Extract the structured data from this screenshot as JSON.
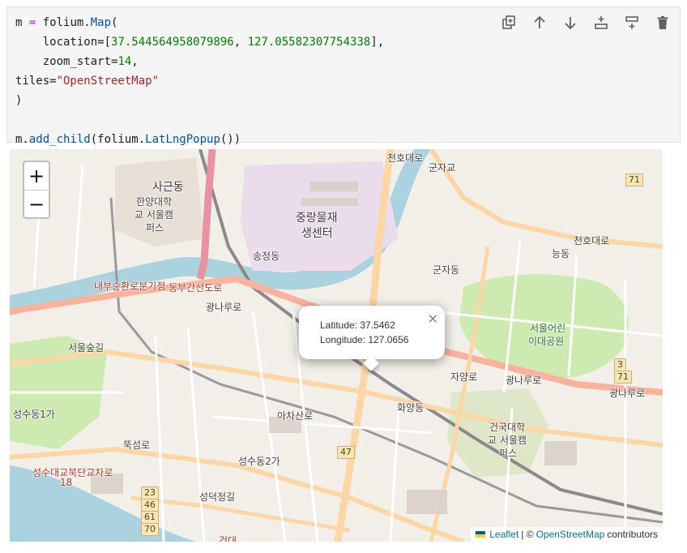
{
  "cell": {
    "code_lines": [
      [
        "m ",
        "=",
        " folium.",
        "Map",
        "("
      ],
      [
        "    location=[",
        "37.544564958079896",
        ", ",
        "127.05582307754338",
        "],"
      ],
      [
        "    zoom_start=",
        "14",
        ","
      ],
      [
        "tiles=",
        "\"OpenStreetMap\""
      ],
      [
        ")"
      ],
      [
        ""
      ],
      [
        "m.",
        "add_child",
        "(folium.",
        "LatLngPopup",
        "())"
      ]
    ],
    "toolbar": [
      {
        "name": "duplicate-icon"
      },
      {
        "name": "arrow-up-icon"
      },
      {
        "name": "arrow-down-icon"
      },
      {
        "name": "insert-above-icon"
      },
      {
        "name": "insert-below-icon"
      },
      {
        "name": "trash-icon"
      }
    ]
  },
  "map": {
    "zoom_in": "+",
    "zoom_out": "−",
    "labels": {
      "sageun": "사근동",
      "hanyang1": "한양대학",
      "hanyang2": "교 서울캠",
      "hanyang3": "퍼스",
      "jungnang1": "중랑물재",
      "jungnang2": "생센터",
      "songjeong": "송정동",
      "gunja": "군자동",
      "gunjagyo": "군자교",
      "neung": "능동",
      "childpark1": "서울어린",
      "childpark2": "이대공원",
      "seoulsup": "서울숲길",
      "hwayang": "화양동",
      "konkuk1": "건국대학",
      "konkuk2": "교 서울캠",
      "konkuk3": "퍼스",
      "seongsu1": "성수동1가",
      "seongsu2": "성수동2가",
      "seongdeok": "성덕정길",
      "ttukseom": "뚝섬로",
      "achasan": "아차산로",
      "gwangnaru": "광나루로",
      "jayang": "자양로",
      "seongsubr": "성수대교북단교차로",
      "cheonho": "천호대로",
      "naebu": "내부순환로분기점",
      "dongbu": "동부간선도로",
      "geondae": "건대"
    },
    "shields": [
      "71",
      "3",
      "71",
      "47",
      "23",
      "46",
      "61",
      "70",
      "18"
    ],
    "popup": {
      "latitude": "Latitude: 37.5462",
      "longitude": "Longitude: 127.0656",
      "close": "×"
    },
    "attribution": {
      "leaflet": "Leaflet",
      "sep": " | © ",
      "osm": "OpenStreetMap",
      "contrib": " contributors"
    }
  }
}
